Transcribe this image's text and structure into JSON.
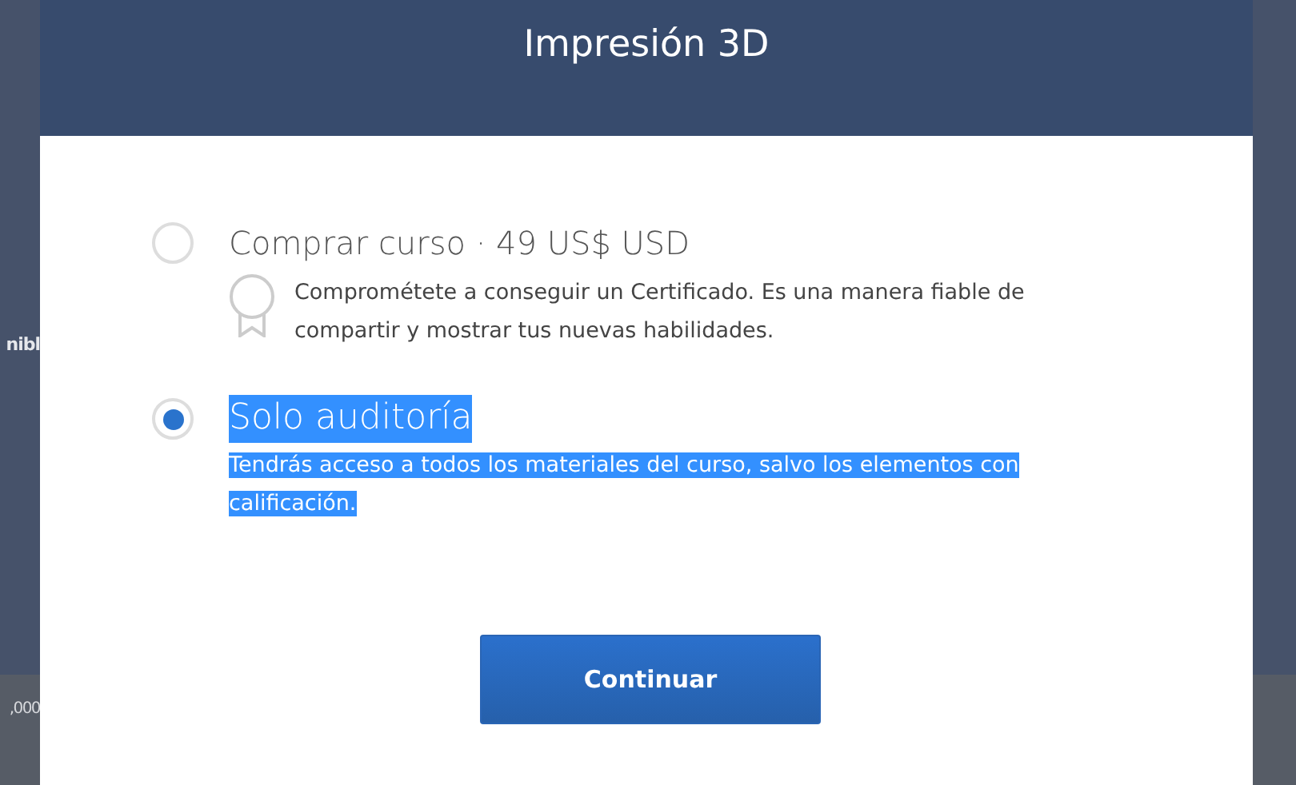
{
  "background": {
    "left_texts": [
      "nibl",
      ",000"
    ]
  },
  "modal": {
    "title": "Impresión 3D",
    "options": [
      {
        "title": "Comprar curso · 49 US$ USD",
        "description": "Comprométete a conseguir un Certificado. Es una manera fiable de compartir y mostrar tus nuevas habilidades.",
        "selected": false,
        "text_highlighted": false,
        "kind": "certificate"
      },
      {
        "title": "Solo auditoría",
        "description": "Tendrás acceso a todos los materiales del curso, salvo los elementos con calificación.",
        "selected": true,
        "text_highlighted": true,
        "kind": "plain"
      }
    ],
    "button": "Continuar"
  }
}
